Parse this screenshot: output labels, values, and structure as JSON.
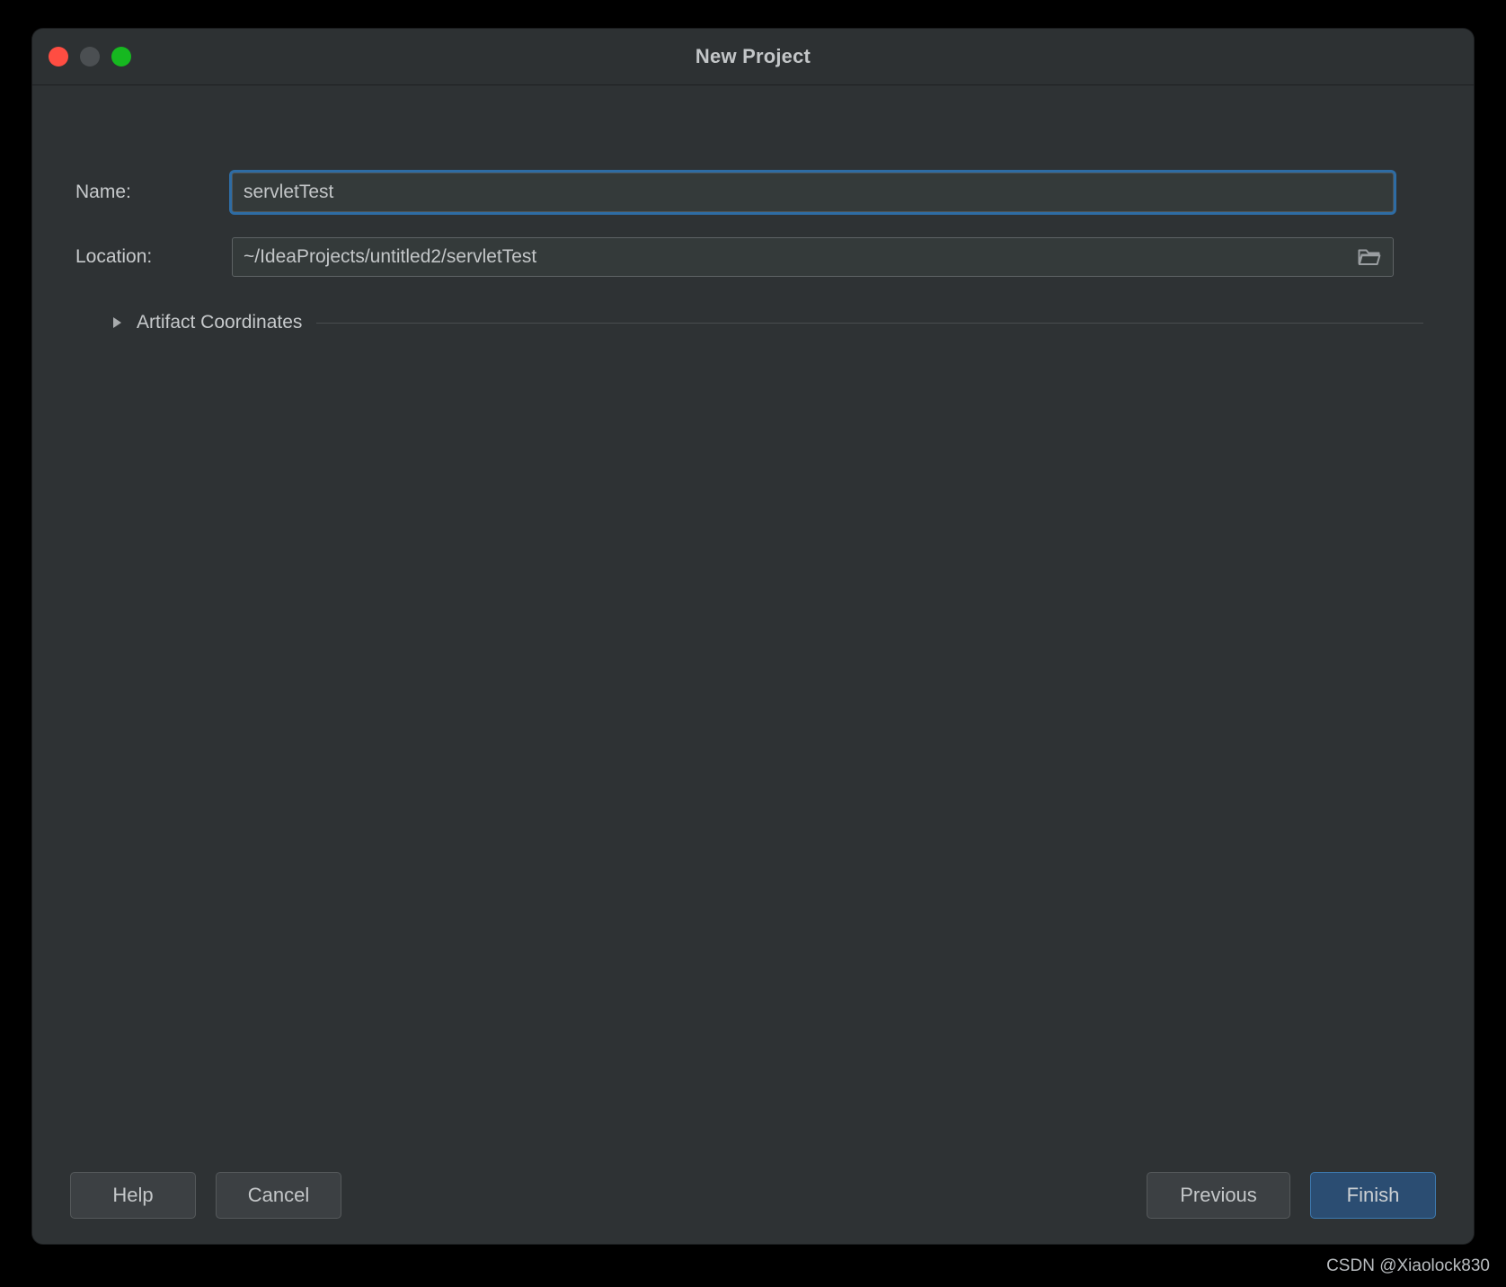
{
  "window": {
    "title": "New Project",
    "traffic_lights": [
      {
        "name": "close-button",
        "color": "#ff4d42"
      },
      {
        "name": "minimize-button",
        "color": "#4b4f52"
      },
      {
        "name": "maximize-button",
        "color": "#16b820"
      }
    ]
  },
  "form": {
    "name_field": {
      "label": "Name:",
      "value": "servletTest",
      "placeholder": "",
      "focused": true
    },
    "location_field": {
      "label": "Location:",
      "value": "~/IdeaProjects/untitled2/servletTest",
      "placeholder": "",
      "browse_icon": "folder-icon"
    }
  },
  "sections": {
    "artifact_coordinates": {
      "label": "Artifact Coordinates",
      "expanded": false,
      "disclosure_icon": "triangle-right-icon"
    }
  },
  "footer": {
    "help_label": "Help",
    "cancel_label": "Cancel",
    "previous_label": "Previous",
    "finish_label": "Finish"
  },
  "watermark": "CSDN @Xiaolock830",
  "colors": {
    "window_bg": "#2e3234",
    "titlebar_bg": "#2d3133",
    "input_bg": "#343a3a",
    "focus_ring": "#2e6ca4",
    "primary_button": "#2b4d72",
    "text": "#c7cacc"
  }
}
